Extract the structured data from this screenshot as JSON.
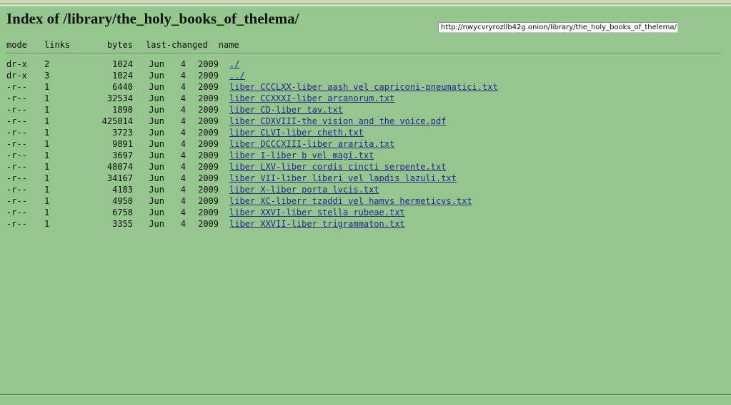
{
  "browser": {
    "url_value": "http://nwycvryrozllb42g.onion/library/the_holy_books_of_thelema/",
    "url_placeholder": "Enter address"
  },
  "colors": {
    "page_background": "#95c68d",
    "link": "#27278b",
    "text": "#101010",
    "rule": "#5d7a59",
    "url_box_background": "#ffffff"
  },
  "page": {
    "title": "Index of /library/the_holy_books_of_thelema/"
  },
  "listing": {
    "headers": {
      "mode": "mode",
      "links": "links",
      "bytes": "bytes",
      "last_changed": "last-changed",
      "name": "name"
    },
    "rows": [
      {
        "mode": "dr-x",
        "links": "2",
        "bytes": "1024",
        "month": "Jun",
        "day": "4",
        "year": "2009",
        "name": "./",
        "is_link": true
      },
      {
        "mode": "dr-x",
        "links": "3",
        "bytes": "1024",
        "month": "Jun",
        "day": "4",
        "year": "2009",
        "name": "../",
        "is_link": true
      },
      {
        "mode": "-r--",
        "links": "1",
        "bytes": "6440",
        "month": "Jun",
        "day": "4",
        "year": "2009",
        "name": "liber CCCLXX-liber aash vel capriconi-pneumatici.txt",
        "is_link": true
      },
      {
        "mode": "-r--",
        "links": "1",
        "bytes": "32534",
        "month": "Jun",
        "day": "4",
        "year": "2009",
        "name": "liber CCXXXI-liber arcanorum.txt",
        "is_link": true
      },
      {
        "mode": "-r--",
        "links": "1",
        "bytes": "1890",
        "month": "Jun",
        "day": "4",
        "year": "2009",
        "name": "liber CD-liber tav.txt",
        "is_link": true
      },
      {
        "mode": "-r--",
        "links": "1",
        "bytes": "425014",
        "month": "Jun",
        "day": "4",
        "year": "2009",
        "name": "liber CDXVIII-the vision and the voice.pdf",
        "is_link": true
      },
      {
        "mode": "-r--",
        "links": "1",
        "bytes": "3723",
        "month": "Jun",
        "day": "4",
        "year": "2009",
        "name": "liber CLVI-liber cheth.txt",
        "is_link": true
      },
      {
        "mode": "-r--",
        "links": "1",
        "bytes": "9891",
        "month": "Jun",
        "day": "4",
        "year": "2009",
        "name": "liber DCCCXIII-liber ararita.txt",
        "is_link": true
      },
      {
        "mode": "-r--",
        "links": "1",
        "bytes": "3697",
        "month": "Jun",
        "day": "4",
        "year": "2009",
        "name": "liber I-liber b vel magi.txt",
        "is_link": true
      },
      {
        "mode": "-r--",
        "links": "1",
        "bytes": "48074",
        "month": "Jun",
        "day": "4",
        "year": "2009",
        "name": "liber LXV-liber cordis cincti serpente.txt",
        "is_link": true
      },
      {
        "mode": "-r--",
        "links": "1",
        "bytes": "34167",
        "month": "Jun",
        "day": "4",
        "year": "2009",
        "name": "liber VII-liber liberi vel lapdis lazuli.txt",
        "is_link": true
      },
      {
        "mode": "-r--",
        "links": "1",
        "bytes": "4183",
        "month": "Jun",
        "day": "4",
        "year": "2009",
        "name": "liber X-liber porta lvcis.txt",
        "is_link": true
      },
      {
        "mode": "-r--",
        "links": "1",
        "bytes": "4950",
        "month": "Jun",
        "day": "4",
        "year": "2009",
        "name": "liber XC-liberr tzaddi vel hamvs hermeticvs.txt",
        "is_link": true
      },
      {
        "mode": "-r--",
        "links": "1",
        "bytes": "6758",
        "month": "Jun",
        "day": "4",
        "year": "2009",
        "name": "liber XXVI-liber stella rubeae.txt",
        "is_link": true
      },
      {
        "mode": "-r--",
        "links": "1",
        "bytes": "3355",
        "month": "Jun",
        "day": "4",
        "year": "2009",
        "name": "liber XXVII-liber trigrammaton.txt",
        "is_link": true
      }
    ]
  }
}
